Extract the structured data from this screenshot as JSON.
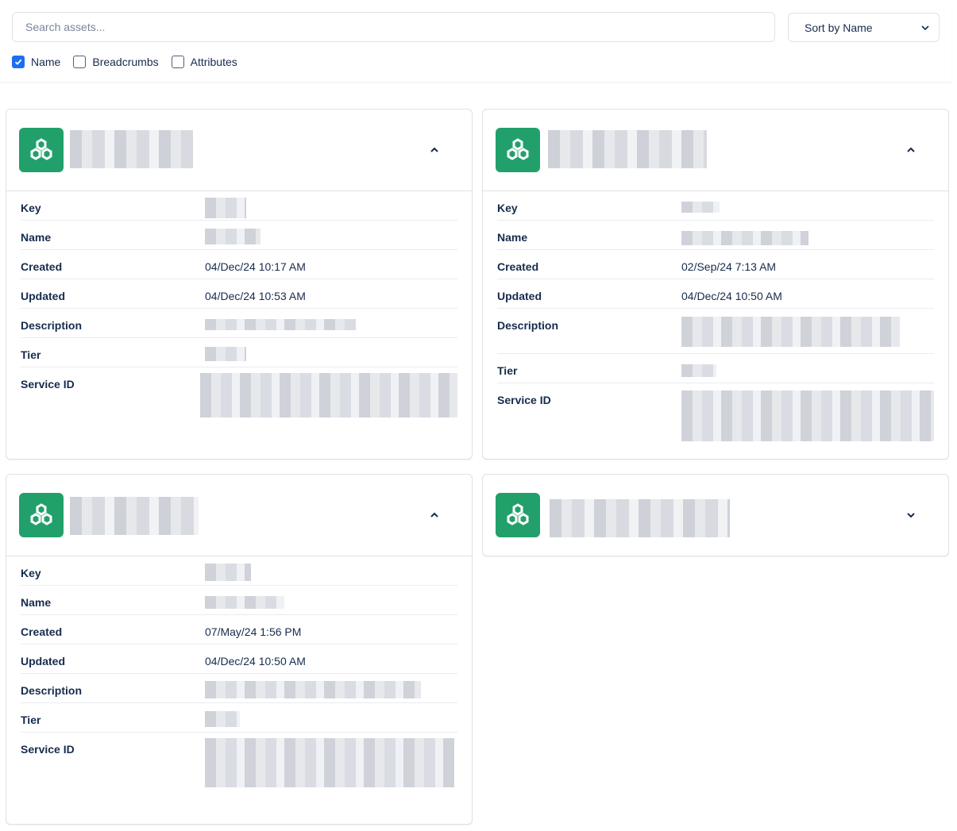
{
  "toolbar": {
    "search_placeholder": "Search assets...",
    "sort_label": "Sort by Name",
    "checkboxes": [
      {
        "label": "Name",
        "checked": true
      },
      {
        "label": "Breadcrumbs",
        "checked": false
      },
      {
        "label": "Attributes",
        "checked": false
      }
    ]
  },
  "labels": {
    "key": "Key",
    "name": "Name",
    "created": "Created",
    "updated": "Updated",
    "description": "Description",
    "tier": "Tier",
    "service_id": "Service ID"
  },
  "cards": [
    {
      "expanded": true,
      "created": "04/Dec/24 10:17 AM",
      "updated": "04/Dec/24 10:53 AM",
      "icon": "hexagon-cluster-icon",
      "toggle_icon": "chevron-up-icon"
    },
    {
      "expanded": true,
      "created": "02/Sep/24 7:13 AM",
      "updated": "04/Dec/24 10:50 AM",
      "icon": "hexagon-cluster-icon",
      "toggle_icon": "chevron-up-icon"
    },
    {
      "expanded": true,
      "created": "07/May/24 1:56 PM",
      "updated": "04/Dec/24 10:50 AM",
      "icon": "hexagon-cluster-icon",
      "toggle_icon": "chevron-up-icon"
    },
    {
      "expanded": false,
      "icon": "hexagon-cluster-icon",
      "toggle_icon": "chevron-down-icon"
    }
  ],
  "colors": {
    "accent": "#1d6ff2",
    "logo": "#22a06b",
    "text": "#172b4d"
  }
}
